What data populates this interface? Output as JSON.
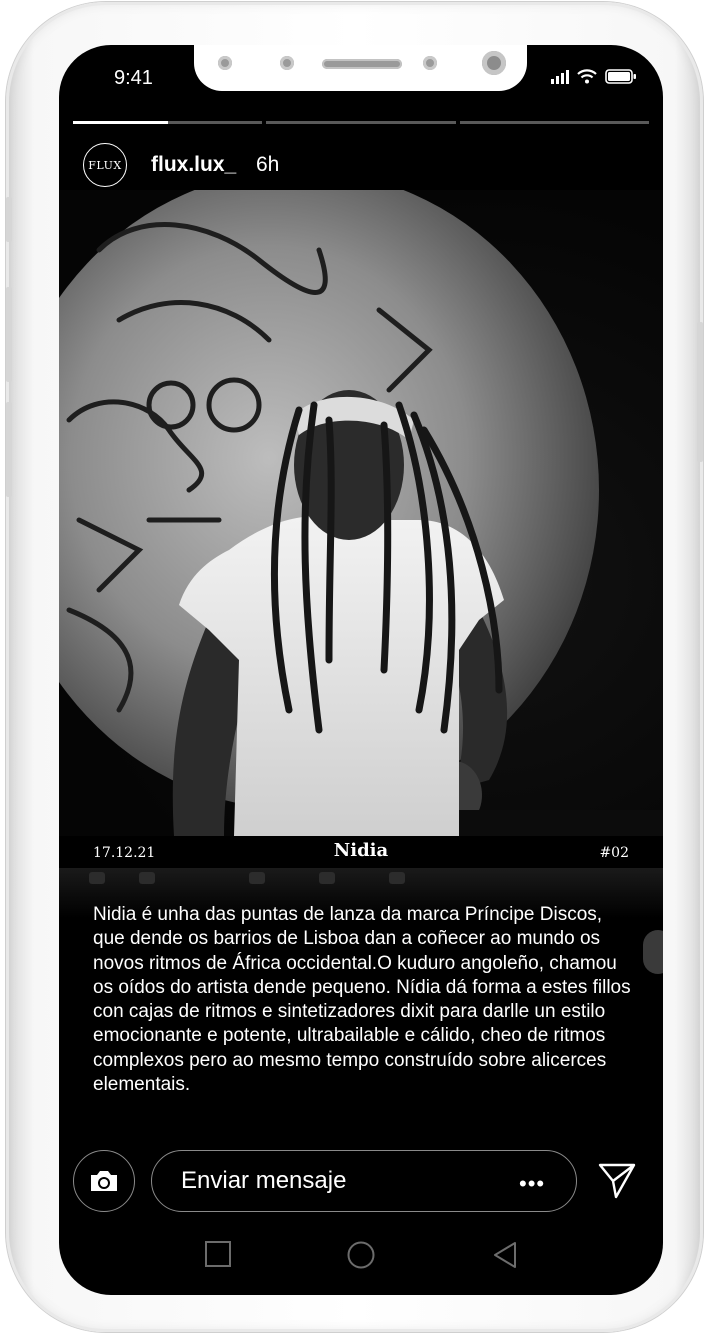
{
  "status": {
    "time": "9:41"
  },
  "story": {
    "progress": [
      0.5,
      0.0,
      0.0
    ],
    "username": "flux.lux_",
    "avatar_text": "FLUX",
    "time_ago": "6h"
  },
  "caption": {
    "date": "17.12.21",
    "name": "Nidia",
    "number": "#02",
    "description": "Nidia é unha das puntas de lanza da marca Príncipe Discos, que dende os barrios de Lisboa dan a coñecer ao mundo os novos ritmos de África occidental.O kuduro angoleño, chamou os oídos do artista dende pequeno. Nídia dá forma a estes fillos con cajas de ritmos e sintetizadores dixit para darlle un estilo emocionante e potente, ultrabailable e cálido, cheo de ritmos complexos pero ao mesmo tempo construído sobre alicerces elementais."
  },
  "reply": {
    "placeholder": "Enviar mensaje",
    "more": "•••"
  },
  "icons": {
    "camera": "camera-icon",
    "send": "send-icon",
    "nav_square": "recent-apps-icon",
    "nav_circle": "home-icon",
    "nav_triangle": "back-icon"
  }
}
